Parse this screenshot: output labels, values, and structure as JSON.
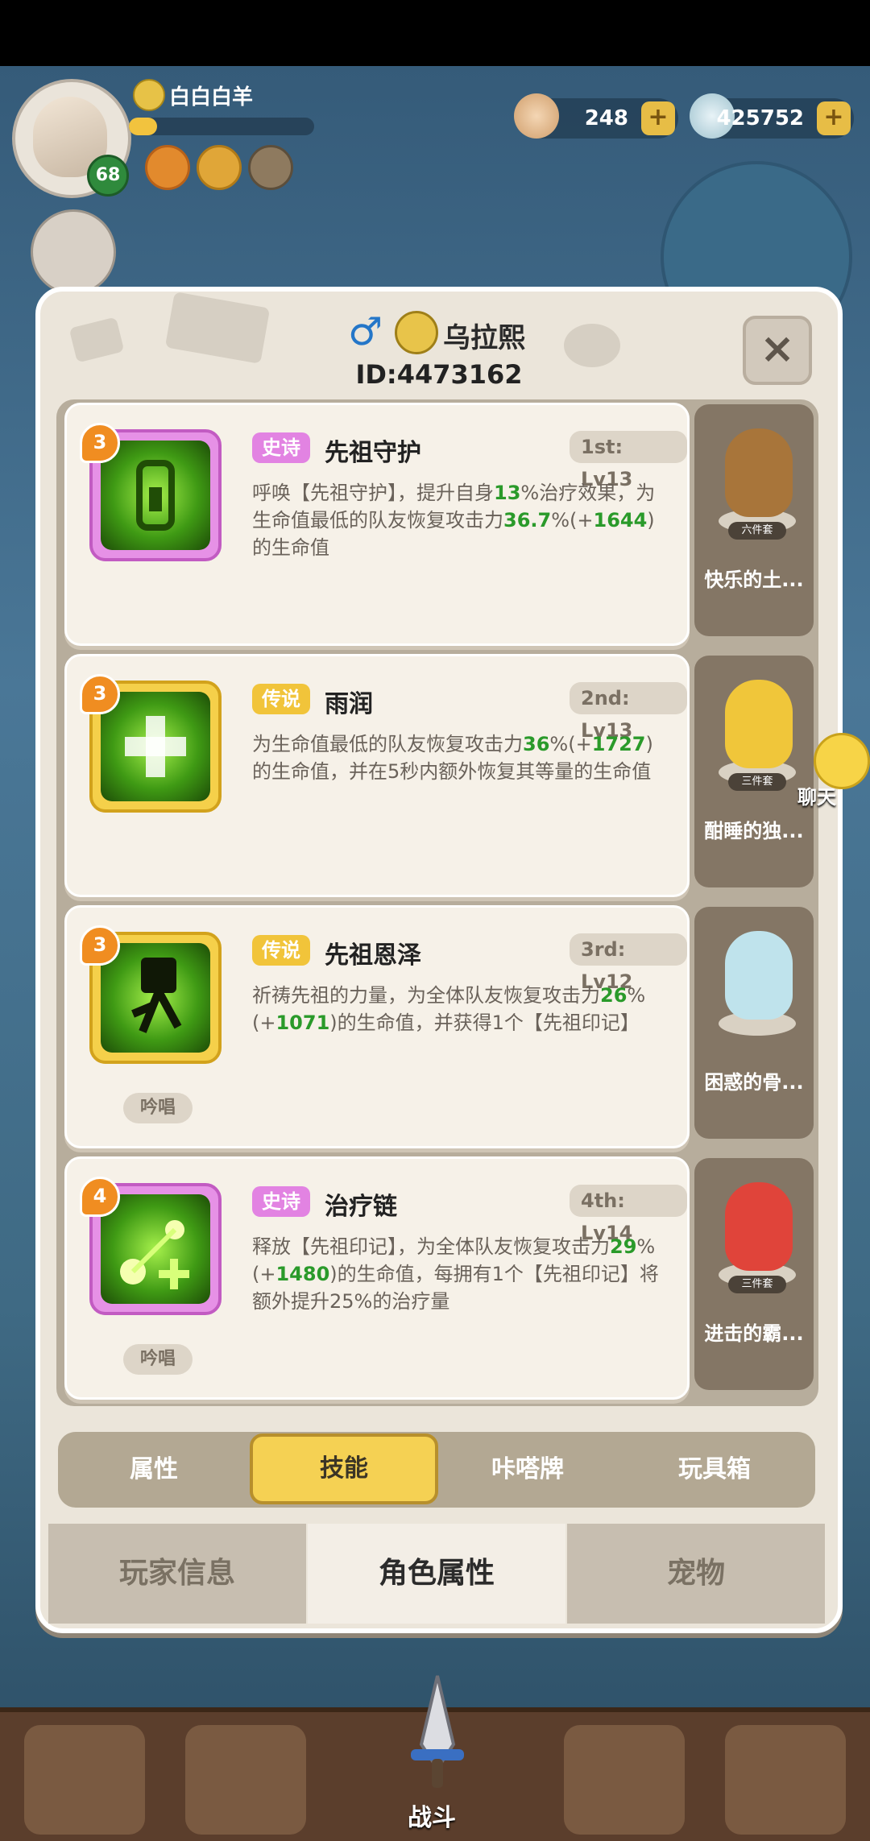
{
  "hud": {
    "player_name": "白白白羊",
    "level": "68",
    "exp_fraction": 0.15,
    "shells": "248",
    "pearls": "425752"
  },
  "modal": {
    "character_name": "乌拉熙",
    "character_id": "ID:4473162",
    "close_label": "×",
    "skills": [
      {
        "level": "3",
        "rarity": "史诗",
        "name": "先祖守护",
        "slot": "1st: Lv13",
        "desc": [
          {
            "t": "呼唤【先祖守护】，提升自身"
          },
          {
            "t": "13",
            "h": true
          },
          {
            "t": "%治疗效果，为生命值最低的队友恢复攻击力"
          },
          {
            "t": "36.7",
            "h": true
          },
          {
            "t": "%(+"
          },
          {
            "t": "1644",
            "h": true
          },
          {
            "t": ")的生命值"
          }
        ],
        "chant": ""
      },
      {
        "level": "3",
        "rarity": "传说",
        "name": "雨润",
        "slot": "2nd: Lv13",
        "desc": [
          {
            "t": "为生命值最低的队友恢复攻击力"
          },
          {
            "t": "36",
            "h": true
          },
          {
            "t": "%(+"
          },
          {
            "t": "1727",
            "h": true
          },
          {
            "t": ")的生命值，并在5秒内额外恢复其等量的生命值"
          }
        ],
        "chant": ""
      },
      {
        "level": "3",
        "rarity": "传说",
        "name": "先祖恩泽",
        "slot": "3rd: Lv12",
        "desc": [
          {
            "t": "祈祷先祖的力量，为全体队友恢复攻击力"
          },
          {
            "t": "26",
            "h": true
          },
          {
            "t": "%(+"
          },
          {
            "t": "1071",
            "h": true
          },
          {
            "t": ")的生命值，并获得1个【先祖印记】"
          }
        ],
        "chant": "吟唱"
      },
      {
        "level": "4",
        "rarity": "史诗",
        "name": "治疗链",
        "slot": "4th: Lv14",
        "desc": [
          {
            "t": "释放【先祖印记】，为全体队友恢复攻击力"
          },
          {
            "t": "29",
            "h": true
          },
          {
            "t": "%(+"
          },
          {
            "t": "1480",
            "h": true
          },
          {
            "t": ")的生命值，每拥有1个【先祖印记】将额外提升25%的治疗量"
          }
        ],
        "chant": "吟唱"
      }
    ],
    "suits": [
      {
        "name": "快乐的土...",
        "badge": "六件套",
        "color": "#a8753a"
      },
      {
        "name": "酣睡的独...",
        "badge": "三件套",
        "color": "#f0c63a"
      },
      {
        "name": "困惑的骨...",
        "badge": "",
        "color": "#bfe3ec"
      },
      {
        "name": "进击的霸...",
        "badge": "三件套",
        "color": "#e0443a"
      }
    ],
    "subtabs": [
      "属性",
      "技能",
      "咔嗒牌",
      "玩具箱"
    ],
    "active_subtab": 1,
    "maintabs": [
      "玩家信息",
      "角色属性",
      "宠物"
    ],
    "active_maintab": 1
  },
  "chat_label": "聊天",
  "battle_label": "战斗"
}
